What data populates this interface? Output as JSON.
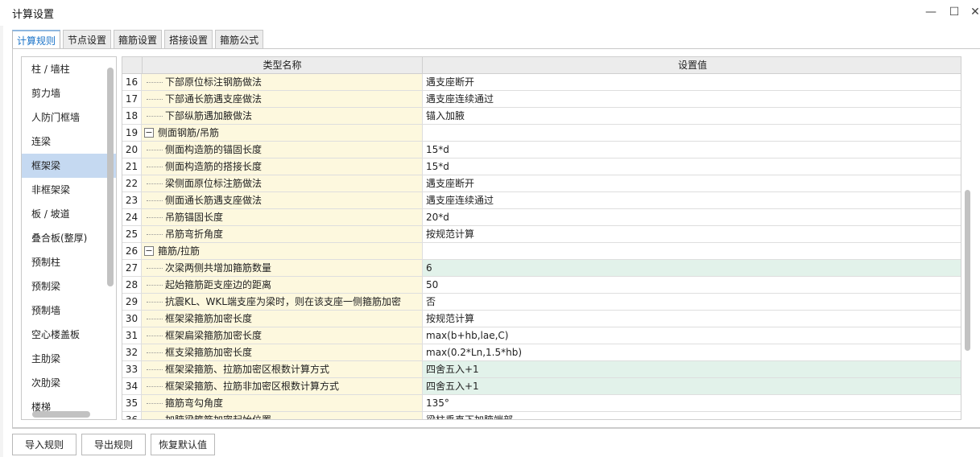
{
  "window": {
    "title": "计算设置",
    "minimize_glyph": "—",
    "maximize_glyph": "☐",
    "close_glyph": "✕"
  },
  "tabs": [
    {
      "label": "计算规则",
      "active": true
    },
    {
      "label": "节点设置",
      "active": false
    },
    {
      "label": "箍筋设置",
      "active": false
    },
    {
      "label": "搭接设置",
      "active": false
    },
    {
      "label": "箍筋公式",
      "active": false
    }
  ],
  "sidebar": {
    "items": [
      {
        "label": "柱 / 墙柱"
      },
      {
        "label": "剪力墙"
      },
      {
        "label": "人防门框墙"
      },
      {
        "label": "连梁"
      },
      {
        "label": "框架梁",
        "selected": true
      },
      {
        "label": "非框架梁"
      },
      {
        "label": "板 / 坡道"
      },
      {
        "label": "叠合板(整厚)"
      },
      {
        "label": "预制柱"
      },
      {
        "label": "预制梁"
      },
      {
        "label": "预制墙"
      },
      {
        "label": "空心楼盖板"
      },
      {
        "label": "主肋梁"
      },
      {
        "label": "次肋梁"
      },
      {
        "label": "楼梯"
      }
    ]
  },
  "grid": {
    "header": {
      "name": "类型名称",
      "value": "设置值"
    },
    "rows": [
      {
        "num": "16",
        "name": "下部原位标注钢筋做法",
        "value": "遇支座断开"
      },
      {
        "num": "17",
        "name": "下部通长筋遇支座做法",
        "value": "遇支座连续通过"
      },
      {
        "num": "18",
        "name": "下部纵筋遇加腋做法",
        "value": "锚入加腋"
      },
      {
        "num": "19",
        "name": "侧面钢筋/吊筋",
        "value": "",
        "group": true,
        "expander": "−"
      },
      {
        "num": "20",
        "name": "侧面构造筋的锚固长度",
        "value": "15*d"
      },
      {
        "num": "21",
        "name": "侧面构造筋的搭接长度",
        "value": "15*d"
      },
      {
        "num": "22",
        "name": "梁侧面原位标注筋做法",
        "value": "遇支座断开"
      },
      {
        "num": "23",
        "name": "侧面通长筋遇支座做法",
        "value": "遇支座连续通过"
      },
      {
        "num": "24",
        "name": "吊筋锚固长度",
        "value": "20*d"
      },
      {
        "num": "25",
        "name": "吊筋弯折角度",
        "value": "按规范计算"
      },
      {
        "num": "26",
        "name": "箍筋/拉筋",
        "value": "",
        "group": true,
        "expander": "−"
      },
      {
        "num": "27",
        "name": "次梁两侧共增加箍筋数量",
        "value": "6",
        "highlight": true
      },
      {
        "num": "28",
        "name": "起始箍筋距支座边的距离",
        "value": "50"
      },
      {
        "num": "29",
        "name": "抗震KL、WKL端支座为梁时，则在该支座一侧箍筋加密",
        "value": "否"
      },
      {
        "num": "30",
        "name": "框架梁箍筋加密长度",
        "value": "按规范计算"
      },
      {
        "num": "31",
        "name": "框架扁梁箍筋加密长度",
        "value": "max(b+hb,lae,C)"
      },
      {
        "num": "32",
        "name": "框支梁箍筋加密长度",
        "value": "max(0.2*Ln,1.5*hb)"
      },
      {
        "num": "33",
        "name": "框架梁箍筋、拉筋加密区根数计算方式",
        "value": "四舍五入+1",
        "highlight": true
      },
      {
        "num": "34",
        "name": "框架梁箍筋、拉筋非加密区根数计算方式",
        "value": "四舍五入+1",
        "highlight": true
      },
      {
        "num": "35",
        "name": "箍筋弯勾角度",
        "value": "135°"
      },
      {
        "num": "36",
        "name": "加腋梁箍筋加密起始位置",
        "value": "梁柱垂直下加腋端部"
      }
    ]
  },
  "buttons": {
    "import": "导入规则",
    "export": "导出规则",
    "restore": "恢复默认值"
  },
  "colors": {
    "name_cell_bg": "#fdf8de",
    "highlight_value_bg": "#e2f2ea",
    "selected_item_bg": "#c5d9f1",
    "active_tab_text": "#1a73c8"
  }
}
